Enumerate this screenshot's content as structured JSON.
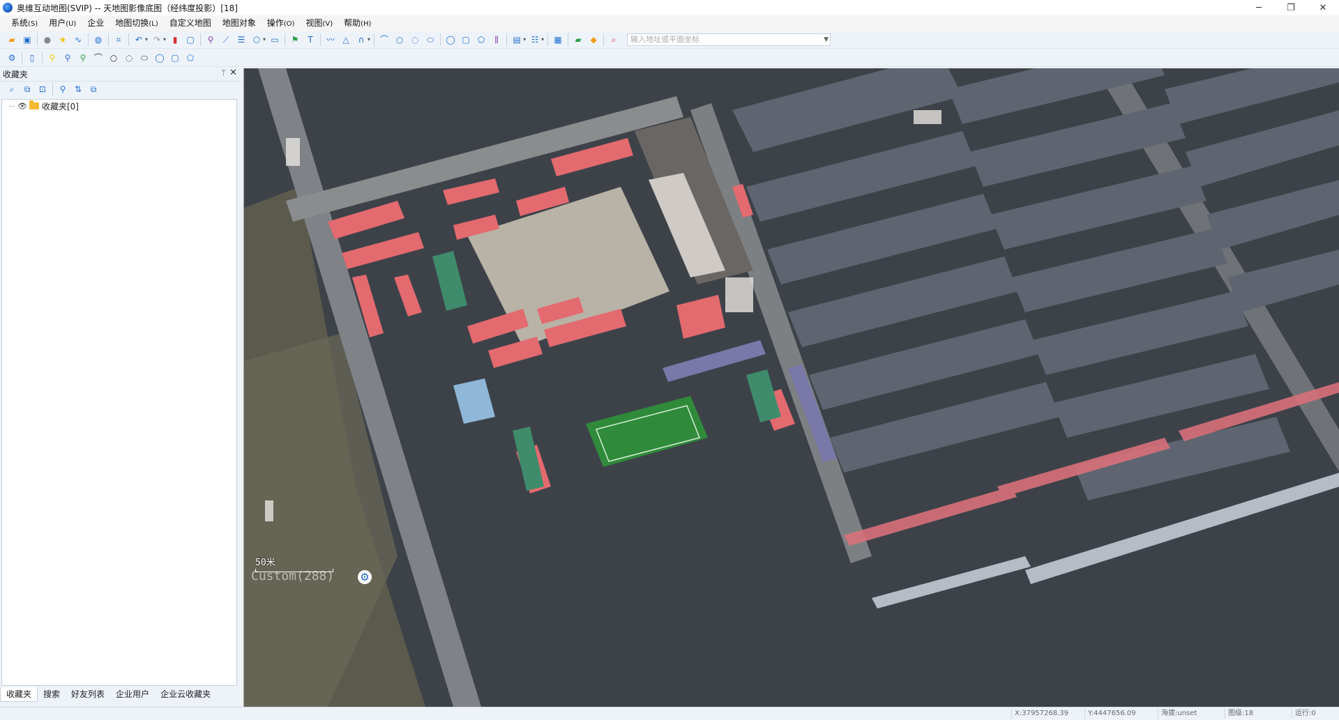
{
  "window": {
    "title": "奥维互动地图(SVIP) -- 天地图影像底图（经纬度投影）[18]",
    "minimize": "─",
    "maximize": "❐",
    "close": "✕"
  },
  "menu": [
    {
      "label": "系统",
      "accel": "(S)"
    },
    {
      "label": "用户",
      "accel": "(U)"
    },
    {
      "label": "企业",
      "accel": ""
    },
    {
      "label": "地图切换",
      "accel": "(L)"
    },
    {
      "label": "自定义地图",
      "accel": ""
    },
    {
      "label": "地图对象",
      "accel": ""
    },
    {
      "label": "操作",
      "accel": "(O)"
    },
    {
      "label": "视图",
      "accel": "(V)"
    },
    {
      "label": "帮助",
      "accel": "(H)"
    }
  ],
  "toolbar": {
    "search": {
      "placeholder": "输入地址或平面坐标",
      "value": ""
    },
    "colors": {
      "orange": "#f39c12",
      "blue": "#1f6fd1",
      "red": "#d32f2f",
      "green": "#2e9e44",
      "purple": "#8e44ad",
      "yellow": "#f1c40f"
    }
  },
  "panel": {
    "title": "收藏夹",
    "pin": "ᛘ",
    "close": "✕",
    "tree": [
      {
        "label": "收藏夹[0]"
      }
    ],
    "tabs": [
      {
        "label": "收藏夹",
        "active": true
      },
      {
        "label": "搜索",
        "active": false
      },
      {
        "label": "好友列表",
        "active": false
      },
      {
        "label": "企业用户",
        "active": false
      },
      {
        "label": "企业云收藏夹",
        "active": false
      }
    ]
  },
  "map": {
    "scale_label": "50米",
    "layer_label": "Custom(288)",
    "settings_icon": "gear-icon"
  },
  "status": {
    "x": "X:37957268.39",
    "y": "Y:4447656.09",
    "altitude": "海拔:unset",
    "zoom": "图级:18",
    "run": "运行:0"
  }
}
